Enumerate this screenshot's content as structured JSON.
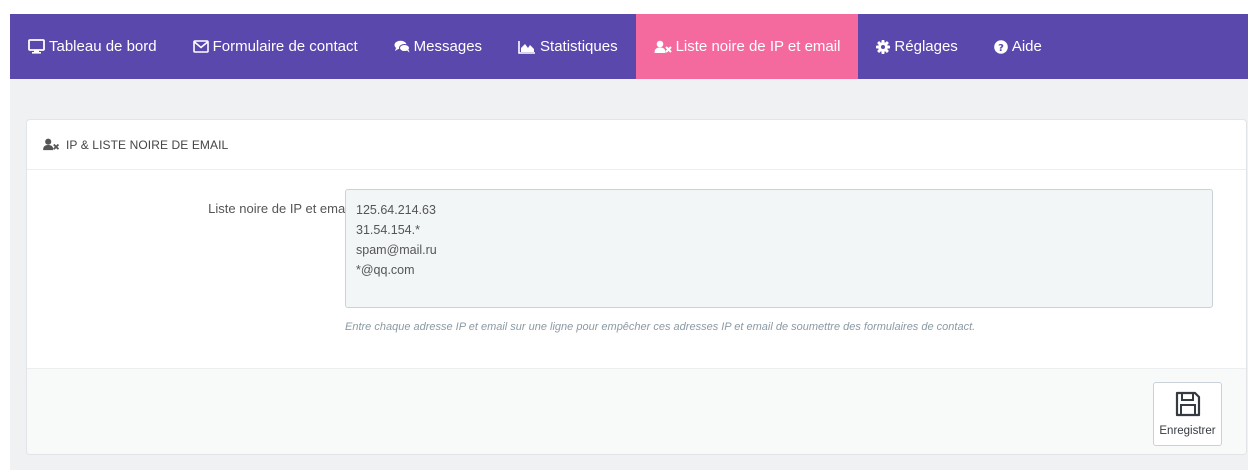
{
  "nav": {
    "items": [
      {
        "label": "Tableau de bord",
        "icon": "desktop-icon",
        "active": false
      },
      {
        "label": "Formulaire de contact",
        "icon": "envelope-icon",
        "active": false
      },
      {
        "label": "Messages",
        "icon": "comments-icon",
        "active": false
      },
      {
        "label": "Statistiques",
        "icon": "area-chart-icon",
        "active": false
      },
      {
        "label": "Liste noire de IP et email",
        "icon": "user-times-icon",
        "active": true
      },
      {
        "label": "Réglages",
        "icon": "cog-icon",
        "active": false
      },
      {
        "label": "Aide",
        "icon": "question-circle-icon",
        "active": false
      }
    ]
  },
  "panel": {
    "title": "IP & LISTE NOIRE DE EMAIL",
    "title_icon": "user-times-icon"
  },
  "form": {
    "blacklist_label": "Liste noire de IP et email",
    "blacklist_value": "125.64.214.63\n31.54.154.*\nspam@mail.ru\n*@qq.com",
    "help_text": "Entre chaque adresse IP et email sur une ligne pour empêcher ces adresses IP et email de soumettre des formulaires de contact."
  },
  "footer": {
    "save_label": "Enregistrer",
    "save_icon": "floppy-disk-icon"
  },
  "colors": {
    "nav_background": "#5a48ad",
    "nav_active": "#f56a9e",
    "page_background": "#eff1f2"
  }
}
